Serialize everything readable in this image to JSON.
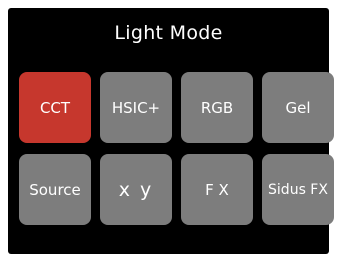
{
  "title": "Light Mode",
  "colors": {
    "background": "#000000",
    "tile": "#7d7d7d",
    "active_tile": "#c6372d",
    "text": "#ffffff"
  },
  "modes": [
    {
      "label": "CCT",
      "active": true
    },
    {
      "label": "HSIC+",
      "active": false
    },
    {
      "label": "RGB",
      "active": false
    },
    {
      "label": "Gel",
      "active": false
    },
    {
      "label": "Source",
      "active": false
    },
    {
      "label": "x y",
      "active": false
    },
    {
      "label": "F X",
      "active": false
    },
    {
      "label": "Sidus FX",
      "active": false
    }
  ]
}
